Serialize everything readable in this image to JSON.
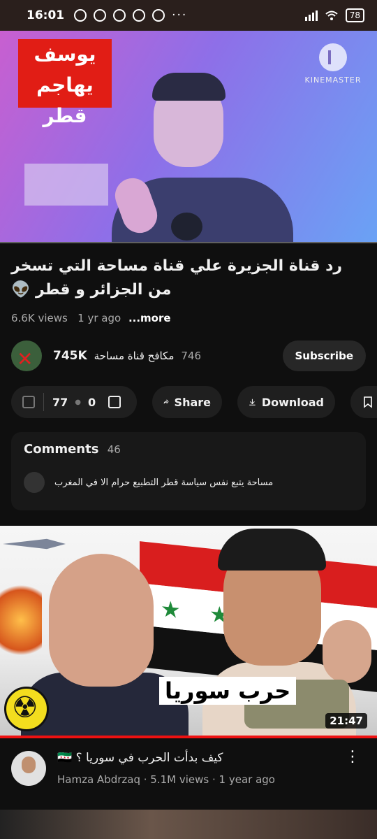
{
  "status_bar": {
    "time": "16:01",
    "battery": "78",
    "dots": "···"
  },
  "player": {
    "overlay_text_line1": "يوسف",
    "overlay_text_line2": "يهاجم قطر",
    "watermark": "KINEMASTER"
  },
  "video": {
    "title": "رد قناة الجزيرة علي قناة مساحة التي تسخر من الجزائر و قطر 👽",
    "views": "6.6K views",
    "age": "1 yr ago",
    "more_label": "...more"
  },
  "channel": {
    "subscribers": "745K",
    "name": "مكافح قناة مساحة",
    "count": "746",
    "subscribe_label": "Subscribe"
  },
  "actions": {
    "likes": "77",
    "dislikes": "0",
    "share_label": "Share",
    "download_label": "Download"
  },
  "comments": {
    "label": "Comments",
    "count": "46",
    "top_comment": "مساحة يتبع نفس سياسة قطر التطبيع حرام الا في المغرب"
  },
  "next_video": {
    "thumb_title": "حرب سوريا",
    "duration": "21:47",
    "title": "كيف بدأت الحرب في سوريا ؟ 🇸🇾",
    "channel": "Hamza Abdrzaq",
    "views": "5.1M views",
    "age": "1 year ago",
    "meta_separator": " · "
  }
}
